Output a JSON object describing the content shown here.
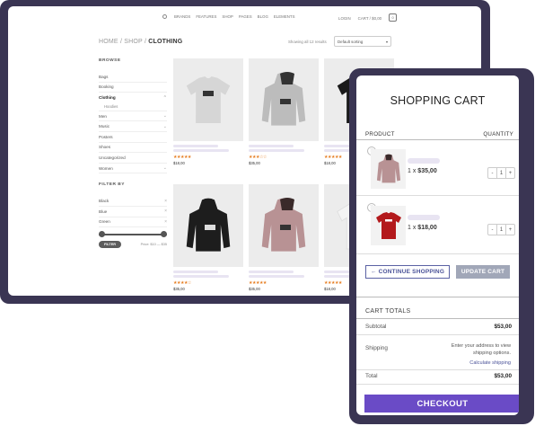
{
  "colors": {
    "frame": "#3a3553",
    "accent": "#6a4bc6",
    "link": "#4a5298",
    "stars": "#e67e22",
    "update_btn": "#a1a7b8"
  },
  "shop": {
    "nav": {
      "search_icon": "search-icon",
      "items": [
        "BRANDS",
        "FEATURES",
        "SHOP",
        "PAGES",
        "BLOG",
        "ELEMENTS"
      ],
      "login": "LOGIN",
      "cart": "CART / $0,00",
      "cart_count": "0"
    },
    "breadcrumb": {
      "home": "HOME",
      "shop": "SHOP",
      "current": "CLOTHING",
      "sep": "/"
    },
    "showing": "Showing all 12 results",
    "sort": "Default sorting",
    "sidebar": {
      "browse_heading": "BROWSE",
      "items": [
        {
          "label": "Bags"
        },
        {
          "label": "Booking"
        },
        {
          "label": "Clothing"
        },
        {
          "label": "Hoodies"
        },
        {
          "label": "Men"
        },
        {
          "label": "Music"
        },
        {
          "label": "Posters"
        },
        {
          "label": "Shoes"
        },
        {
          "label": "Uncategorized"
        },
        {
          "label": "Women"
        }
      ],
      "filter_heading": "FILTER BY",
      "filters": [
        {
          "label": "Black"
        },
        {
          "label": "Blue"
        },
        {
          "label": "Green"
        }
      ],
      "filter_button": "FILTER",
      "price_range": "Price: $10 — $35"
    },
    "products": [
      {
        "stars": "★★★★★",
        "price": "$18,00",
        "icon": "tshirt-white-icon"
      },
      {
        "stars": "★★★☆☆",
        "price": "$35,00",
        "icon": "hoodie-gray-icon"
      },
      {
        "stars": "★★★★★",
        "price": "$18,00",
        "icon": "tshirt-black-icon"
      },
      {
        "stars": "★★★★☆",
        "price": "$35,00",
        "icon": "hoodie-black-icon"
      },
      {
        "stars": "★★★★★",
        "price": "$35,00",
        "icon": "hoodie-pink-icon"
      },
      {
        "stars": "★★★★★",
        "price": "$18,00",
        "icon": "tshirt-white-icon"
      }
    ]
  },
  "cart": {
    "title": "SHOPPING CART",
    "col_product": "PRODUCT",
    "col_quantity": "QUANTITY",
    "items": [
      {
        "qty_line_prefix": "1 x ",
        "price": "$35,00",
        "qty": "1",
        "icon": "hoodie-pink-icon"
      },
      {
        "qty_line_prefix": "1 x ",
        "price": "$18,00",
        "qty": "1",
        "icon": "tshirt-red-icon"
      }
    ],
    "remove_glyph": "×",
    "minus": "-",
    "plus": "+",
    "continue_label": "← CONTINUE SHOPPING",
    "update_label": "UPDATE CART",
    "totals_heading": "CART TOTALS",
    "subtotal_label": "Subtotal",
    "subtotal_value": "$53,00",
    "shipping_label": "Shipping",
    "shipping_note": "Enter your address to view shipping options.",
    "calc_shipping": "Calculate shipping",
    "total_label": "Total",
    "total_value": "$53,00",
    "checkout_label": "CHECKOUT"
  }
}
